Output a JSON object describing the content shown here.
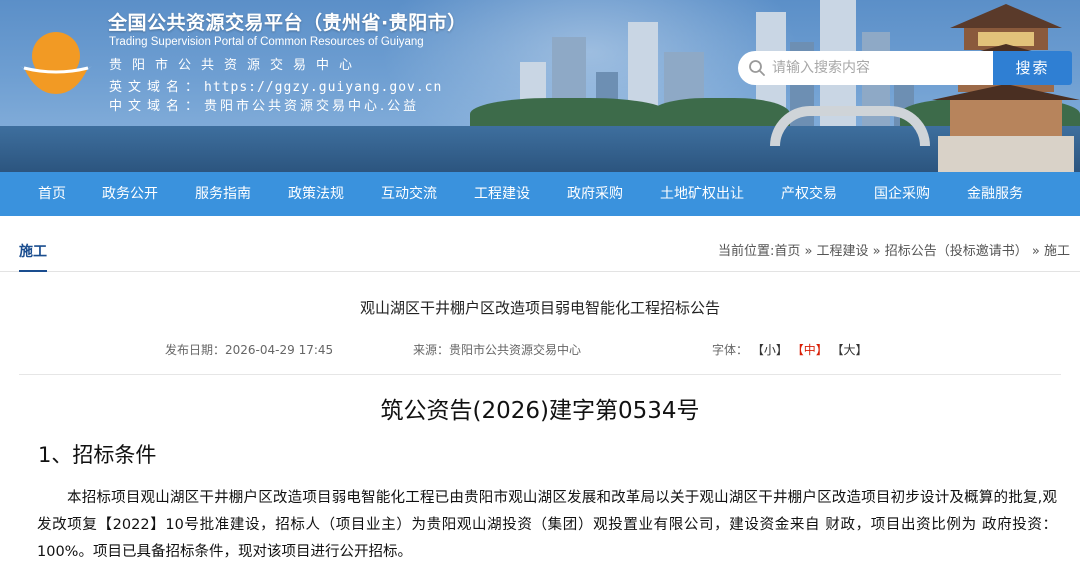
{
  "header": {
    "title": "全国公共资源交易平台（贵州省·贵阳市）",
    "subtitle_en": "Trading Supervision Portal of Common Resources of Guiyang",
    "center_name": "贵阳市公共资源交易中心",
    "en_domain_label": "英文域名：",
    "en_domain_value": "https://ggzy.guiyang.gov.cn",
    "cn_domain_label": "中文域名：",
    "cn_domain_value": "贵阳市公共资源交易中心.公益"
  },
  "search": {
    "placeholder": "请输入搜索内容",
    "button_label": "搜索"
  },
  "nav": {
    "items": [
      {
        "label": "首页"
      },
      {
        "label": "政务公开"
      },
      {
        "label": "服务指南"
      },
      {
        "label": "政策法规"
      },
      {
        "label": "互动交流"
      },
      {
        "label": "工程建设"
      },
      {
        "label": "政府采购"
      },
      {
        "label": "土地矿权出让"
      },
      {
        "label": "产权交易"
      },
      {
        "label": "国企采购"
      },
      {
        "label": "金融服务"
      }
    ]
  },
  "section": {
    "label": "施工",
    "breadcrumb": "当前位置:首页 » 工程建设 » 招标公告（投标邀请书） » 施工"
  },
  "article": {
    "title": "观山湖区干井棚户区改造项目弱电智能化工程招标公告",
    "publish_label": "发布日期：",
    "publish_date": "2026-04-29 17:45",
    "source_label": "来源：",
    "source": "贵阳市公共资源交易中心",
    "font_label": "字体：",
    "font_small": "【小】",
    "font_medium": "【中】",
    "font_large": "【大】",
    "doc_number": "筑公资告(2026)建字第0534号",
    "heading_1": "1、招标条件",
    "paragraph_1": "本招标项目观山湖区干井棚户区改造项目弱电智能化工程已由贵阳市观山湖区发展和改革局以关于观山湖区干井棚户区改造项目初步设计及概算的批复,观发改项复【2022】10号批准建设，招标人（项目业主）为贵阳观山湖投资（集团）观投置业有限公司，建设资金来自 财政，项目出资比例为 政府投资：100%。项目已具备招标条件，现对该项目进行公开招标。"
  },
  "colors": {
    "nav_bg": "#3a92dd",
    "search_button": "#2f7fd3",
    "section_label": "#1a4d8f",
    "font_active": "#d81e06"
  }
}
